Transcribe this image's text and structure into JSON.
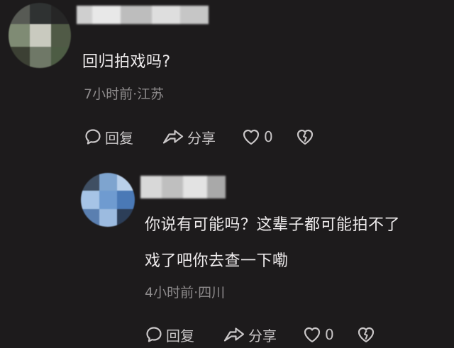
{
  "comments": [
    {
      "text": "回归拍戏吗?",
      "meta": "7小时前·江苏",
      "actions": {
        "reply_label": "回复",
        "share_label": "分享",
        "like_count": "0"
      }
    },
    {
      "text_lines": [
        "你说有可能吗？这辈子都可能拍不了",
        "戏了吧你去查一下嘞"
      ],
      "meta": "4小时前·四川",
      "actions": {
        "reply_label": "回复",
        "share_label": "分享",
        "like_count": "0"
      }
    }
  ],
  "icons": {
    "reply": "comment-bubble-icon",
    "share": "share-arrow-icon",
    "like": "heart-icon",
    "dislike": "broken-heart-icon"
  },
  "colors": {
    "background": "#1d1b1c",
    "text": "#eeebec",
    "meta": "#8e8b8c",
    "action": "#c9c6c7"
  }
}
